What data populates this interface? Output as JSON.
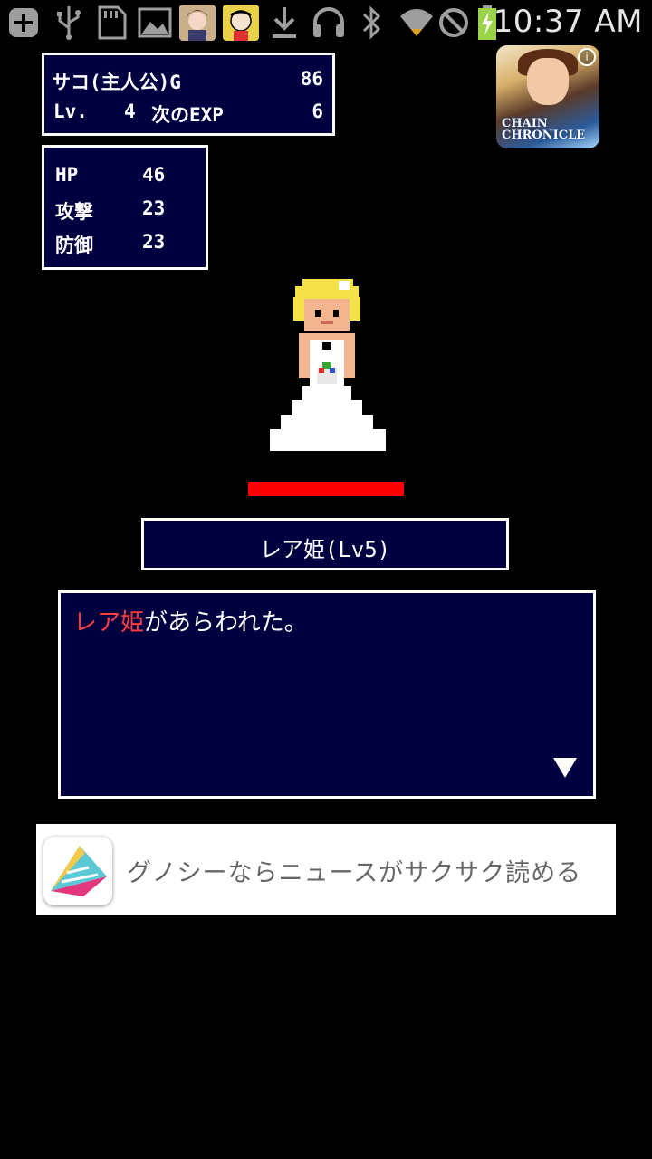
{
  "status_bar": {
    "time": "10:37 AM",
    "icons": [
      "add-icon",
      "usb-icon",
      "sd-card-icon",
      "image-icon",
      "app-notification-icon",
      "app-notification-icon",
      "download-icon",
      "headphones-icon",
      "bluetooth-icon",
      "wifi-icon",
      "no-sign-icon",
      "battery-charging-icon"
    ]
  },
  "player": {
    "name": "サコ(主人公)G",
    "gold": "86",
    "level_label": "Lv.",
    "level": "4",
    "next_exp_label": "次のEXP",
    "next_exp": "6"
  },
  "stats": [
    {
      "label": "HP",
      "value": "46"
    },
    {
      "label": "攻撃",
      "value": "23"
    },
    {
      "label": "防御",
      "value": "23"
    }
  ],
  "enemy": {
    "name_label": "レア姫(Lv5)",
    "hp_fraction": 1.0,
    "hp_color": "#ff0000"
  },
  "message": {
    "highlight": "レア姫",
    "rest": "があらわれた。",
    "highlight_color": "#ff3b3b"
  },
  "promo_icon": {
    "logo_line1": "CHAIN",
    "logo_line2": "CHRONICLE",
    "info_glyph": "i"
  },
  "ad": {
    "text": "グノシーならニュースがサクサク読める"
  },
  "colors": {
    "window_bg": "#000040",
    "window_border": "#ffffff"
  }
}
